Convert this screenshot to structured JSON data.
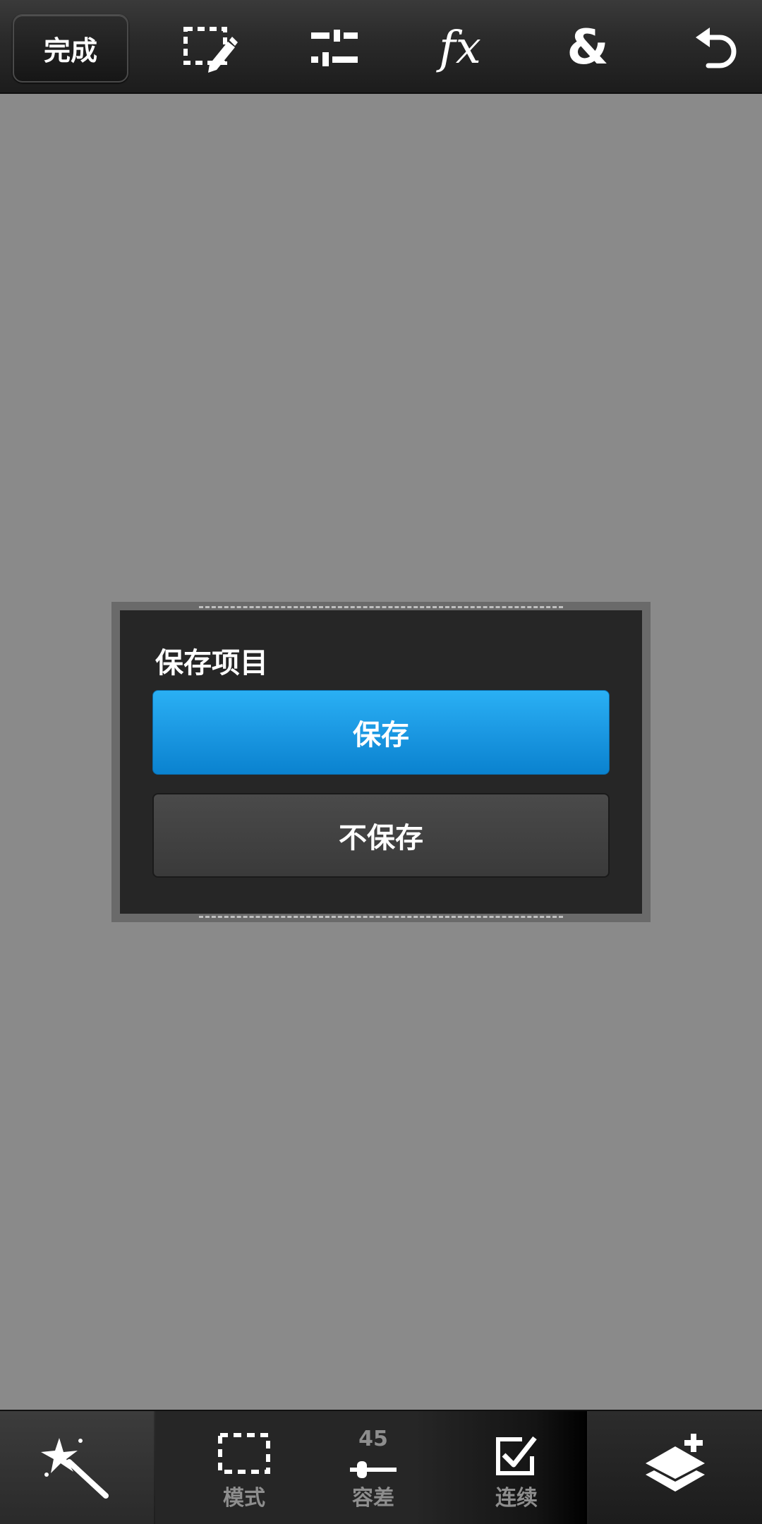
{
  "toolbar": {
    "done_label": "完成",
    "icons": [
      "selection-edit-icon",
      "adjustments-icon",
      "fx-icon",
      "blend-icon",
      "undo-icon"
    ],
    "fx_text": "fx",
    "amp_text": "&"
  },
  "dialog": {
    "title": "保存项目",
    "save_label": "保存",
    "nosave_label": "不保存",
    "save_color": "#1b98e2"
  },
  "bottom": {
    "mode_label": "模式",
    "tolerance_value": "45",
    "tolerance_label": "容差",
    "contiguous_label": "连续",
    "icons": [
      "magic-wand-icon",
      "marquee-icon",
      "slider-icon",
      "checkbox-icon",
      "add-layer-icon"
    ]
  },
  "colors": {
    "canvas": "#8a8a8a",
    "bar": "#262626",
    "accent": "#1b98e2"
  }
}
